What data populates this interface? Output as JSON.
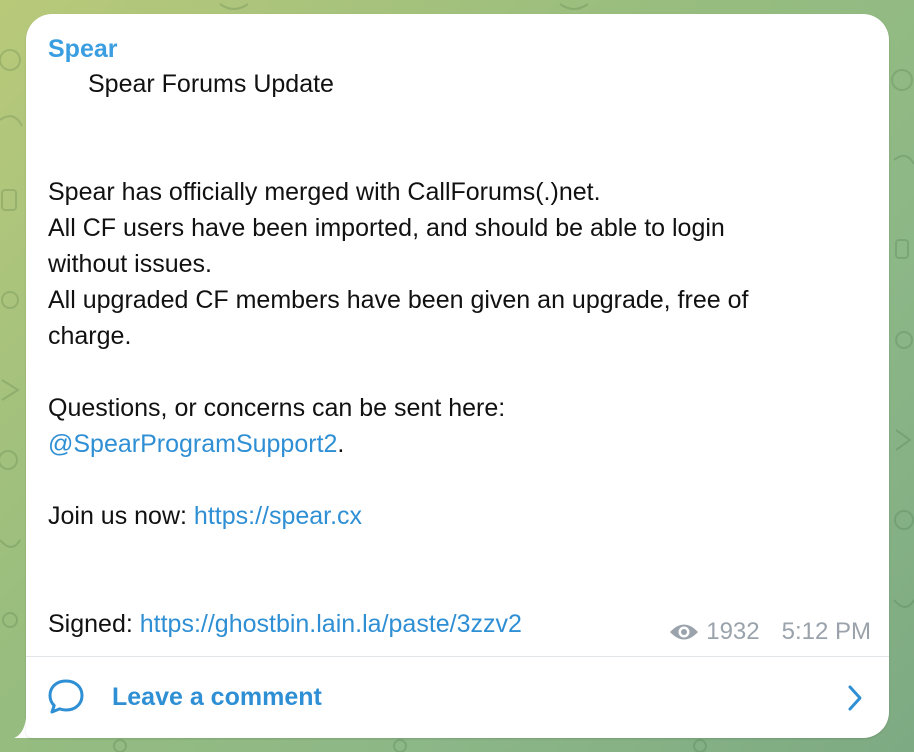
{
  "post": {
    "author": "Spear",
    "title": "Spear Forums Update",
    "paragraph1": [
      "Spear has officially merged with CallForums(.)net.",
      "All CF users have been imported, and should be able to login",
      "without issues.",
      "All upgraded CF members have been given an upgrade, free of",
      "charge."
    ],
    "questions_text": "Questions, or concerns can be sent here:",
    "support_handle": "@SpearProgramSupport2",
    "support_suffix": ".",
    "join_text": "Join us now: ",
    "join_link": "https://spear.cx",
    "signed_text": "Signed: ",
    "signed_link": "https://ghostbin.lain.la/paste/3zzv2"
  },
  "meta": {
    "views": "1932",
    "time": "5:12 PM"
  },
  "comment": {
    "label": "Leave a comment"
  },
  "colors": {
    "accent": "#3a9ee0",
    "link": "#2f8fd4",
    "meta": "#9aa3ab",
    "background": "#98bd7e"
  },
  "icons": {
    "views": "eye-icon",
    "comment": "comment-bubble-icon",
    "arrow": "chevron-right-icon"
  }
}
